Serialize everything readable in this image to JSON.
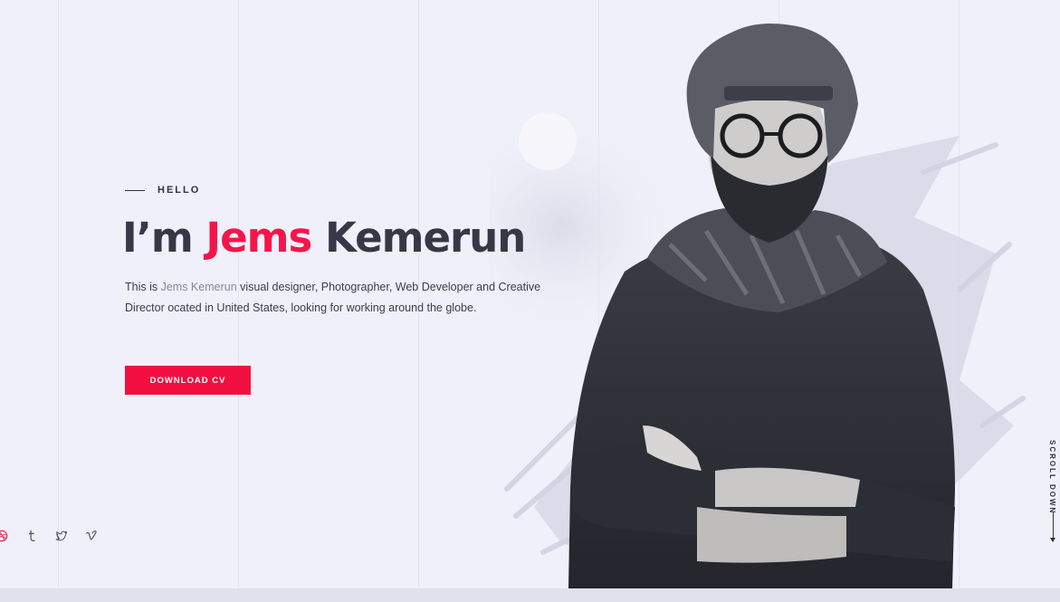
{
  "hero": {
    "eyebrow": "HELLO",
    "headline_prefix": "I’m ",
    "headline_highlight": "Jems",
    "headline_suffix": " Kemerun",
    "intro_before": "This is ",
    "intro_name": "Jems Kemerun",
    "intro_after": " visual designer, Photographer, Web Developer and Creative Director ocated in United States, looking for working around the globe.",
    "cta_label": "DOWNLOAD CV"
  },
  "socials": [
    {
      "icon": "dribbble-icon"
    },
    {
      "icon": "tumblr-icon"
    },
    {
      "icon": "twitter-icon"
    },
    {
      "icon": "vimeo-icon"
    }
  ],
  "scroll": {
    "label": "SCROLL DOWN"
  },
  "colors": {
    "background": "#eff0fa",
    "accent": "#f4164a",
    "text": "#363848",
    "muted": "#868896"
  }
}
